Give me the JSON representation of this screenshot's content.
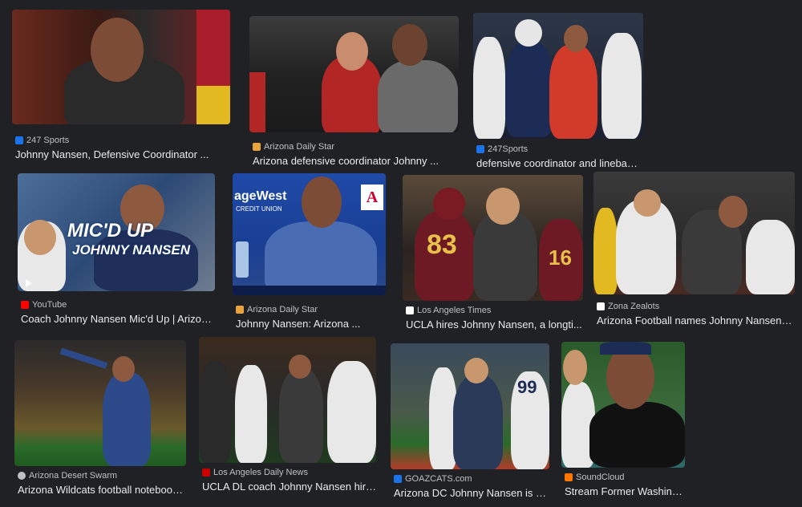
{
  "results": [
    {
      "source": "247 Sports",
      "title": "Johnny Nansen, Defensive Coordinator ...",
      "favicon_color": "#1a73e8"
    },
    {
      "source": "Arizona Daily Star",
      "title": "Arizona defensive coordinator Johnny ...",
      "favicon_color": "#e8a33d"
    },
    {
      "source": "247Sports",
      "title": "defensive coordinator and lineback...",
      "favicon_color": "#1a73e8"
    },
    {
      "source": "YouTube",
      "title": "Coach Johnny Nansen Mic'd Up | Arizona...",
      "favicon_color": "#ff0000",
      "overlay_line1": "MIC'D UP",
      "overlay_line2": "JOHNNY NANSEN"
    },
    {
      "source": "Arizona Daily Star",
      "title": "Johnny Nansen: Arizona ...",
      "favicon_color": "#e8a33d",
      "backdrop_text": "ageWest",
      "backdrop_subtext": "CREDIT UNION",
      "logo_text": "A"
    },
    {
      "source": "Los Angeles Times",
      "title": "UCLA hires Johnny Nansen, a longti...",
      "favicon_color": "#ffffff",
      "jersey_left": "83",
      "jersey_right": "16"
    },
    {
      "source": "Zona Zealots",
      "title": "Arizona Football names Johnny Nansen a...",
      "favicon_color": "#ffffff"
    },
    {
      "source": "Arizona Desert Swarm",
      "title": "Arizona Wildcats football notebook...",
      "favicon_color": "#bdc1c6"
    },
    {
      "source": "Los Angeles Daily News",
      "title": "UCLA DL coach Johnny Nansen hire...",
      "favicon_color": "#cc0000"
    },
    {
      "source": "GOAZCATS.com",
      "title": "Arizona DC Johnny Nansen is h...",
      "favicon_color": "#1a73e8",
      "jersey": "99"
    },
    {
      "source": "SoundCloud",
      "title": "Stream Former Washing...",
      "favicon_color": "#ff7700"
    }
  ]
}
